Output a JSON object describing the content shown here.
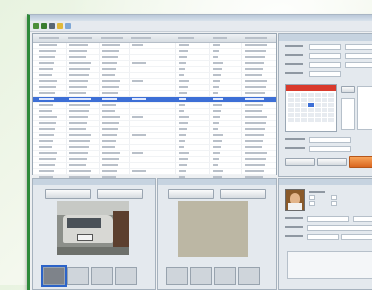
{
  "window": {
    "title": ""
  },
  "toolbar": {
    "buttons": [
      "back-icon",
      "forward-icon",
      "camera-icon",
      "folder-icon",
      "refresh-icon"
    ]
  },
  "list": {
    "rows": 24,
    "selected_row": 9
  },
  "calendar": {
    "accent": "#d93a2c"
  },
  "colors": {
    "selection": "#3d6fd6",
    "frame": "#2e8a3a",
    "action": "#e07628"
  }
}
